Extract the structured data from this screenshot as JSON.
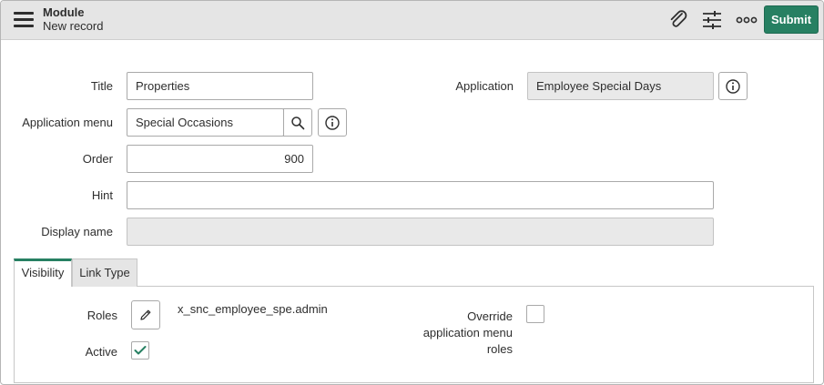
{
  "header": {
    "module_label": "Module",
    "record_label": "New record",
    "submit_label": "Submit",
    "icons": [
      "menu-icon",
      "attachment-icon",
      "settings-sliders-icon",
      "more-options-icon"
    ]
  },
  "form": {
    "title": {
      "label": "Title",
      "value": "Properties"
    },
    "application": {
      "label": "Application",
      "value": "Employee Special Days"
    },
    "application_menu": {
      "label": "Application menu",
      "value": "Special Occasions"
    },
    "order": {
      "label": "Order",
      "value": "900"
    },
    "hint": {
      "label": "Hint",
      "value": ""
    },
    "display_name": {
      "label": "Display name",
      "value": ""
    }
  },
  "tabs": [
    {
      "label": "Visibility",
      "active": true
    },
    {
      "label": "Link Type",
      "active": false
    }
  ],
  "visibility": {
    "roles_label": "Roles",
    "roles_value": "x_snc_employee_spe.admin",
    "active_label": "Active",
    "active_checked": true,
    "override_label": "Override application menu roles",
    "override_lines": [
      "Override",
      "application menu",
      "roles"
    ],
    "override_checked": false
  },
  "colors": {
    "accent": "#278062",
    "header_bg": "#e5e5e5",
    "readonly_bg": "#e9e9e9"
  }
}
